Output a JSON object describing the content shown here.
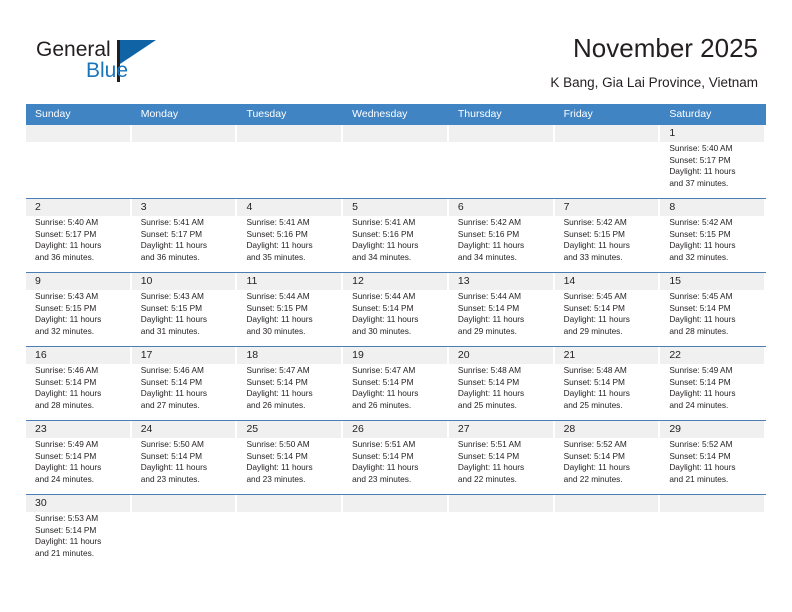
{
  "brand": {
    "name_part1": "General",
    "name_part2": "Blue",
    "accent_color": "#1b75bb",
    "triangle_color": "#1064a5"
  },
  "header": {
    "title": "November 2025",
    "subtitle": "K Bang, Gia Lai Province, Vietnam"
  },
  "calendar": {
    "header_bg": "#4084c4",
    "daynum_bg": "#f0f0f0",
    "row_line_color": "#4a7eb5",
    "weekdays": [
      "Sunday",
      "Monday",
      "Tuesday",
      "Wednesday",
      "Thursday",
      "Friday",
      "Saturday"
    ],
    "weeks": [
      [
        {
          "day": "",
          "sunrise": "",
          "sunset": "",
          "daylight1": "",
          "daylight2": "",
          "empty": true
        },
        {
          "day": "",
          "sunrise": "",
          "sunset": "",
          "daylight1": "",
          "daylight2": "",
          "empty": true
        },
        {
          "day": "",
          "sunrise": "",
          "sunset": "",
          "daylight1": "",
          "daylight2": "",
          "empty": true
        },
        {
          "day": "",
          "sunrise": "",
          "sunset": "",
          "daylight1": "",
          "daylight2": "",
          "empty": true
        },
        {
          "day": "",
          "sunrise": "",
          "sunset": "",
          "daylight1": "",
          "daylight2": "",
          "empty": true
        },
        {
          "day": "",
          "sunrise": "",
          "sunset": "",
          "daylight1": "",
          "daylight2": "",
          "empty": true
        },
        {
          "day": "1",
          "sunrise": "Sunrise: 5:40 AM",
          "sunset": "Sunset: 5:17 PM",
          "daylight1": "Daylight: 11 hours",
          "daylight2": "and 37 minutes.",
          "empty": false
        }
      ],
      [
        {
          "day": "2",
          "sunrise": "Sunrise: 5:40 AM",
          "sunset": "Sunset: 5:17 PM",
          "daylight1": "Daylight: 11 hours",
          "daylight2": "and 36 minutes.",
          "empty": false
        },
        {
          "day": "3",
          "sunrise": "Sunrise: 5:41 AM",
          "sunset": "Sunset: 5:17 PM",
          "daylight1": "Daylight: 11 hours",
          "daylight2": "and 36 minutes.",
          "empty": false
        },
        {
          "day": "4",
          "sunrise": "Sunrise: 5:41 AM",
          "sunset": "Sunset: 5:16 PM",
          "daylight1": "Daylight: 11 hours",
          "daylight2": "and 35 minutes.",
          "empty": false
        },
        {
          "day": "5",
          "sunrise": "Sunrise: 5:41 AM",
          "sunset": "Sunset: 5:16 PM",
          "daylight1": "Daylight: 11 hours",
          "daylight2": "and 34 minutes.",
          "empty": false
        },
        {
          "day": "6",
          "sunrise": "Sunrise: 5:42 AM",
          "sunset": "Sunset: 5:16 PM",
          "daylight1": "Daylight: 11 hours",
          "daylight2": "and 34 minutes.",
          "empty": false
        },
        {
          "day": "7",
          "sunrise": "Sunrise: 5:42 AM",
          "sunset": "Sunset: 5:15 PM",
          "daylight1": "Daylight: 11 hours",
          "daylight2": "and 33 minutes.",
          "empty": false
        },
        {
          "day": "8",
          "sunrise": "Sunrise: 5:42 AM",
          "sunset": "Sunset: 5:15 PM",
          "daylight1": "Daylight: 11 hours",
          "daylight2": "and 32 minutes.",
          "empty": false
        }
      ],
      [
        {
          "day": "9",
          "sunrise": "Sunrise: 5:43 AM",
          "sunset": "Sunset: 5:15 PM",
          "daylight1": "Daylight: 11 hours",
          "daylight2": "and 32 minutes.",
          "empty": false
        },
        {
          "day": "10",
          "sunrise": "Sunrise: 5:43 AM",
          "sunset": "Sunset: 5:15 PM",
          "daylight1": "Daylight: 11 hours",
          "daylight2": "and 31 minutes.",
          "empty": false
        },
        {
          "day": "11",
          "sunrise": "Sunrise: 5:44 AM",
          "sunset": "Sunset: 5:15 PM",
          "daylight1": "Daylight: 11 hours",
          "daylight2": "and 30 minutes.",
          "empty": false
        },
        {
          "day": "12",
          "sunrise": "Sunrise: 5:44 AM",
          "sunset": "Sunset: 5:14 PM",
          "daylight1": "Daylight: 11 hours",
          "daylight2": "and 30 minutes.",
          "empty": false
        },
        {
          "day": "13",
          "sunrise": "Sunrise: 5:44 AM",
          "sunset": "Sunset: 5:14 PM",
          "daylight1": "Daylight: 11 hours",
          "daylight2": "and 29 minutes.",
          "empty": false
        },
        {
          "day": "14",
          "sunrise": "Sunrise: 5:45 AM",
          "sunset": "Sunset: 5:14 PM",
          "daylight1": "Daylight: 11 hours",
          "daylight2": "and 29 minutes.",
          "empty": false
        },
        {
          "day": "15",
          "sunrise": "Sunrise: 5:45 AM",
          "sunset": "Sunset: 5:14 PM",
          "daylight1": "Daylight: 11 hours",
          "daylight2": "and 28 minutes.",
          "empty": false
        }
      ],
      [
        {
          "day": "16",
          "sunrise": "Sunrise: 5:46 AM",
          "sunset": "Sunset: 5:14 PM",
          "daylight1": "Daylight: 11 hours",
          "daylight2": "and 28 minutes.",
          "empty": false
        },
        {
          "day": "17",
          "sunrise": "Sunrise: 5:46 AM",
          "sunset": "Sunset: 5:14 PM",
          "daylight1": "Daylight: 11 hours",
          "daylight2": "and 27 minutes.",
          "empty": false
        },
        {
          "day": "18",
          "sunrise": "Sunrise: 5:47 AM",
          "sunset": "Sunset: 5:14 PM",
          "daylight1": "Daylight: 11 hours",
          "daylight2": "and 26 minutes.",
          "empty": false
        },
        {
          "day": "19",
          "sunrise": "Sunrise: 5:47 AM",
          "sunset": "Sunset: 5:14 PM",
          "daylight1": "Daylight: 11 hours",
          "daylight2": "and 26 minutes.",
          "empty": false
        },
        {
          "day": "20",
          "sunrise": "Sunrise: 5:48 AM",
          "sunset": "Sunset: 5:14 PM",
          "daylight1": "Daylight: 11 hours",
          "daylight2": "and 25 minutes.",
          "empty": false
        },
        {
          "day": "21",
          "sunrise": "Sunrise: 5:48 AM",
          "sunset": "Sunset: 5:14 PM",
          "daylight1": "Daylight: 11 hours",
          "daylight2": "and 25 minutes.",
          "empty": false
        },
        {
          "day": "22",
          "sunrise": "Sunrise: 5:49 AM",
          "sunset": "Sunset: 5:14 PM",
          "daylight1": "Daylight: 11 hours",
          "daylight2": "and 24 minutes.",
          "empty": false
        }
      ],
      [
        {
          "day": "23",
          "sunrise": "Sunrise: 5:49 AM",
          "sunset": "Sunset: 5:14 PM",
          "daylight1": "Daylight: 11 hours",
          "daylight2": "and 24 minutes.",
          "empty": false
        },
        {
          "day": "24",
          "sunrise": "Sunrise: 5:50 AM",
          "sunset": "Sunset: 5:14 PM",
          "daylight1": "Daylight: 11 hours",
          "daylight2": "and 23 minutes.",
          "empty": false
        },
        {
          "day": "25",
          "sunrise": "Sunrise: 5:50 AM",
          "sunset": "Sunset: 5:14 PM",
          "daylight1": "Daylight: 11 hours",
          "daylight2": "and 23 minutes.",
          "empty": false
        },
        {
          "day": "26",
          "sunrise": "Sunrise: 5:51 AM",
          "sunset": "Sunset: 5:14 PM",
          "daylight1": "Daylight: 11 hours",
          "daylight2": "and 23 minutes.",
          "empty": false
        },
        {
          "day": "27",
          "sunrise": "Sunrise: 5:51 AM",
          "sunset": "Sunset: 5:14 PM",
          "daylight1": "Daylight: 11 hours",
          "daylight2": "and 22 minutes.",
          "empty": false
        },
        {
          "day": "28",
          "sunrise": "Sunrise: 5:52 AM",
          "sunset": "Sunset: 5:14 PM",
          "daylight1": "Daylight: 11 hours",
          "daylight2": "and 22 minutes.",
          "empty": false
        },
        {
          "day": "29",
          "sunrise": "Sunrise: 5:52 AM",
          "sunset": "Sunset: 5:14 PM",
          "daylight1": "Daylight: 11 hours",
          "daylight2": "and 21 minutes.",
          "empty": false
        }
      ],
      [
        {
          "day": "30",
          "sunrise": "Sunrise: 5:53 AM",
          "sunset": "Sunset: 5:14 PM",
          "daylight1": "Daylight: 11 hours",
          "daylight2": "and 21 minutes.",
          "empty": false
        },
        {
          "day": "",
          "sunrise": "",
          "sunset": "",
          "daylight1": "",
          "daylight2": "",
          "empty": true
        },
        {
          "day": "",
          "sunrise": "",
          "sunset": "",
          "daylight1": "",
          "daylight2": "",
          "empty": true
        },
        {
          "day": "",
          "sunrise": "",
          "sunset": "",
          "daylight1": "",
          "daylight2": "",
          "empty": true
        },
        {
          "day": "",
          "sunrise": "",
          "sunset": "",
          "daylight1": "",
          "daylight2": "",
          "empty": true
        },
        {
          "day": "",
          "sunrise": "",
          "sunset": "",
          "daylight1": "",
          "daylight2": "",
          "empty": true
        },
        {
          "day": "",
          "sunrise": "",
          "sunset": "",
          "daylight1": "",
          "daylight2": "",
          "empty": true
        }
      ]
    ]
  }
}
